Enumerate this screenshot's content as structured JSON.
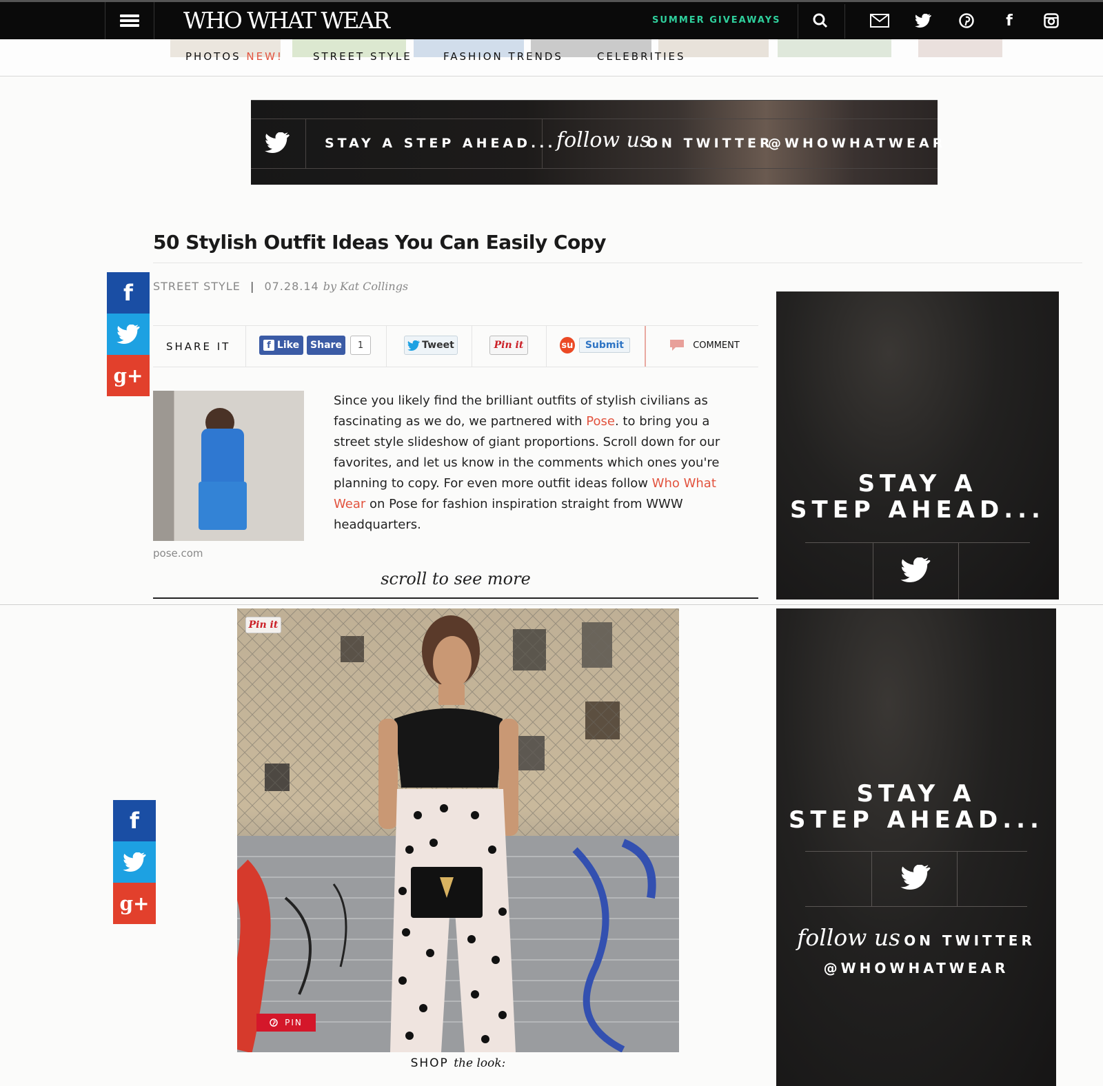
{
  "header": {
    "logo": "WHO WHAT WEAR",
    "giveaways": "SUMMER GIVEAWAYS",
    "icons": [
      "menu-icon",
      "search-icon",
      "mail-icon",
      "twitter-icon",
      "pinterest-icon",
      "facebook-icon",
      "instagram-icon"
    ]
  },
  "nav": {
    "items": [
      {
        "label": "PHOTOS",
        "badge": "NEW!"
      },
      {
        "label": "STREET STYLE"
      },
      {
        "label": "FASHION TRENDS"
      },
      {
        "label": "CELEBRITIES"
      }
    ]
  },
  "banner": {
    "stay": "STAY A STEP AHEAD...",
    "follow_script": "follow us",
    "follow_rest": "ON TWITTER",
    "handle": "@WHOWHATWEAR"
  },
  "article": {
    "title": "50 Stylish Outfit Ideas You Can Easily Copy",
    "category": "STREET STYLE",
    "divider": "|",
    "date": "07.28.14",
    "by": "by Kat Collings",
    "share_label": "SHARE IT",
    "like": "Like",
    "share": "Share",
    "share_count": "1",
    "tweet": "Tweet",
    "pinit": "Pin it",
    "submit": "Submit",
    "comment": "COMMENT",
    "credit": "pose.com",
    "body_1": "Since you likely find the brilliant outfits of stylish civilians as fascinating as we do, we partnered with ",
    "link_pose": "Pose",
    "body_2": ". to bring you a street style slideshow of giant proportions. Scroll down for our favorites, and let us know in the comments which ones you're planning to copy. For even more outfit ideas follow ",
    "link_www": "Who What Wear",
    "body_3": " on Pose for fashion inspiration straight from WWW headquarters.",
    "scroll_more": "scroll to see more"
  },
  "side_ad": {
    "stay_line1": "STAY A",
    "stay_line2": "STEP AHEAD...",
    "follow_script": "follow us",
    "follow_rest": "ON TWITTER",
    "handle": "@WHOWHATWEAR"
  },
  "photo": {
    "pinit": "Pin it",
    "pin": "PIN",
    "shop_caps": "SHOP",
    "shop_italic": "the look:"
  },
  "share_side": {
    "facebook": "f",
    "googleplus": "g+"
  },
  "colors": {
    "accent": "#e2533e",
    "giveaway": "#2fcf9c",
    "facebook": "#1a4ea4",
    "twitter": "#1da1e2",
    "googleplus": "#e2402c"
  }
}
